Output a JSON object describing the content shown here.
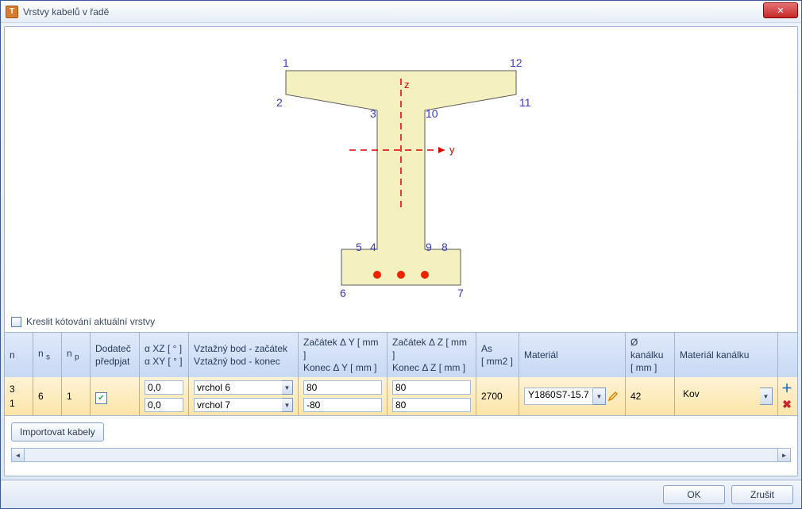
{
  "window": {
    "title": "Vrstvy kabelů v řadě"
  },
  "diagram": {
    "labels": [
      "1",
      "2",
      "3",
      "4",
      "5",
      "6",
      "7",
      "8",
      "9",
      "10",
      "11",
      "12"
    ],
    "axes": {
      "y": "y",
      "z": "z"
    }
  },
  "checkbox": {
    "label": "Kreslit kótování aktuální vrstvy"
  },
  "table": {
    "headers": {
      "n": "n",
      "ns_prefix": "n",
      "ns_sub": "s",
      "np_prefix": "n",
      "np_sub": "p",
      "dod_line1": "Dodateč",
      "dod_line2": "předpjat",
      "axz": "α XZ   [ ° ]",
      "axy": "α XY   [ ° ]",
      "vz_line1": "Vztažný bod - začátek",
      "vz_line2": "Vztažný bod - konec",
      "dy_line1": "Začátek Δ Y  [ mm ]",
      "dy_line2": "Konec Δ Y  [ mm ]",
      "dz_line1": "Začátek Δ Z  [ mm ]",
      "dz_line2": "Konec Δ Z  [ mm ]",
      "as_line1": "As",
      "as_line2": "[ mm2 ]",
      "mat": "Materiál",
      "kan_line1": "Ø kanálku",
      "kan_line2": "[ mm ]",
      "mk": "Materiál kanálku"
    },
    "row": {
      "n": "3",
      "n_sub": "1",
      "ns": "6",
      "np": "1",
      "dod_checked": "✔",
      "axz": "0,0",
      "axy": "0,0",
      "vz_start": "vrchol 6",
      "vz_end": "vrchol 7",
      "dy_start": "80",
      "dy_end": "-80",
      "dz_start": "80",
      "dz_end": "80",
      "as": "2700",
      "material": "Y1860S7-15.7",
      "kan": "42",
      "mk": "Kov"
    }
  },
  "buttons": {
    "import": "Importovat kabely",
    "ok": "OK",
    "cancel": "Zrušit"
  }
}
